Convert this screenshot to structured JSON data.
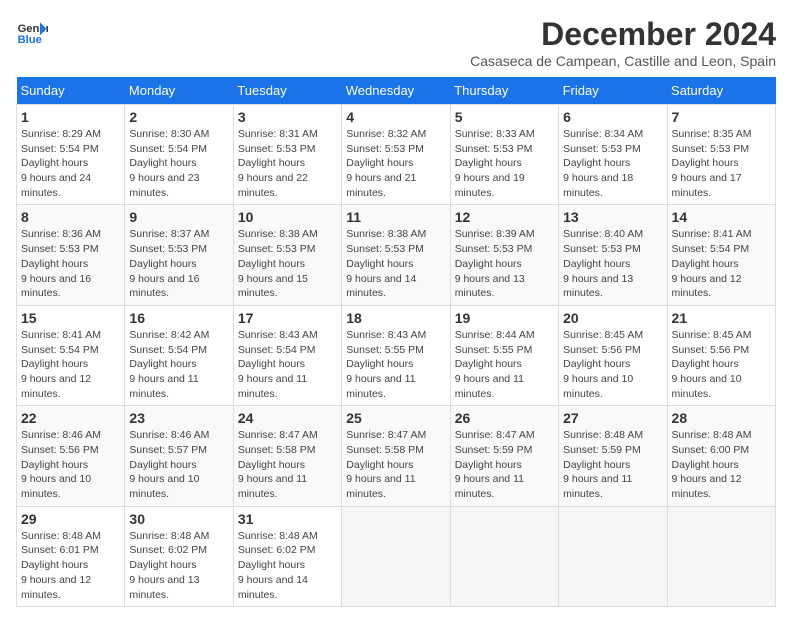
{
  "logo": {
    "line1": "General",
    "line2": "Blue"
  },
  "title": "December 2024",
  "subtitle": "Casaseca de Campean, Castille and Leon, Spain",
  "weekdays": [
    "Sunday",
    "Monday",
    "Tuesday",
    "Wednesday",
    "Thursday",
    "Friday",
    "Saturday"
  ],
  "weeks": [
    [
      {
        "day": "1",
        "sunrise": "8:29 AM",
        "sunset": "5:54 PM",
        "daylight": "9 hours and 24 minutes."
      },
      {
        "day": "2",
        "sunrise": "8:30 AM",
        "sunset": "5:54 PM",
        "daylight": "9 hours and 23 minutes."
      },
      {
        "day": "3",
        "sunrise": "8:31 AM",
        "sunset": "5:53 PM",
        "daylight": "9 hours and 22 minutes."
      },
      {
        "day": "4",
        "sunrise": "8:32 AM",
        "sunset": "5:53 PM",
        "daylight": "9 hours and 21 minutes."
      },
      {
        "day": "5",
        "sunrise": "8:33 AM",
        "sunset": "5:53 PM",
        "daylight": "9 hours and 19 minutes."
      },
      {
        "day": "6",
        "sunrise": "8:34 AM",
        "sunset": "5:53 PM",
        "daylight": "9 hours and 18 minutes."
      },
      {
        "day": "7",
        "sunrise": "8:35 AM",
        "sunset": "5:53 PM",
        "daylight": "9 hours and 17 minutes."
      }
    ],
    [
      {
        "day": "8",
        "sunrise": "8:36 AM",
        "sunset": "5:53 PM",
        "daylight": "9 hours and 16 minutes."
      },
      {
        "day": "9",
        "sunrise": "8:37 AM",
        "sunset": "5:53 PM",
        "daylight": "9 hours and 16 minutes."
      },
      {
        "day": "10",
        "sunrise": "8:38 AM",
        "sunset": "5:53 PM",
        "daylight": "9 hours and 15 minutes."
      },
      {
        "day": "11",
        "sunrise": "8:38 AM",
        "sunset": "5:53 PM",
        "daylight": "9 hours and 14 minutes."
      },
      {
        "day": "12",
        "sunrise": "8:39 AM",
        "sunset": "5:53 PM",
        "daylight": "9 hours and 13 minutes."
      },
      {
        "day": "13",
        "sunrise": "8:40 AM",
        "sunset": "5:53 PM",
        "daylight": "9 hours and 13 minutes."
      },
      {
        "day": "14",
        "sunrise": "8:41 AM",
        "sunset": "5:54 PM",
        "daylight": "9 hours and 12 minutes."
      }
    ],
    [
      {
        "day": "15",
        "sunrise": "8:41 AM",
        "sunset": "5:54 PM",
        "daylight": "9 hours and 12 minutes."
      },
      {
        "day": "16",
        "sunrise": "8:42 AM",
        "sunset": "5:54 PM",
        "daylight": "9 hours and 11 minutes."
      },
      {
        "day": "17",
        "sunrise": "8:43 AM",
        "sunset": "5:54 PM",
        "daylight": "9 hours and 11 minutes."
      },
      {
        "day": "18",
        "sunrise": "8:43 AM",
        "sunset": "5:55 PM",
        "daylight": "9 hours and 11 minutes."
      },
      {
        "day": "19",
        "sunrise": "8:44 AM",
        "sunset": "5:55 PM",
        "daylight": "9 hours and 11 minutes."
      },
      {
        "day": "20",
        "sunrise": "8:45 AM",
        "sunset": "5:56 PM",
        "daylight": "9 hours and 10 minutes."
      },
      {
        "day": "21",
        "sunrise": "8:45 AM",
        "sunset": "5:56 PM",
        "daylight": "9 hours and 10 minutes."
      }
    ],
    [
      {
        "day": "22",
        "sunrise": "8:46 AM",
        "sunset": "5:56 PM",
        "daylight": "9 hours and 10 minutes."
      },
      {
        "day": "23",
        "sunrise": "8:46 AM",
        "sunset": "5:57 PM",
        "daylight": "9 hours and 10 minutes."
      },
      {
        "day": "24",
        "sunrise": "8:47 AM",
        "sunset": "5:58 PM",
        "daylight": "9 hours and 11 minutes."
      },
      {
        "day": "25",
        "sunrise": "8:47 AM",
        "sunset": "5:58 PM",
        "daylight": "9 hours and 11 minutes."
      },
      {
        "day": "26",
        "sunrise": "8:47 AM",
        "sunset": "5:59 PM",
        "daylight": "9 hours and 11 minutes."
      },
      {
        "day": "27",
        "sunrise": "8:48 AM",
        "sunset": "5:59 PM",
        "daylight": "9 hours and 11 minutes."
      },
      {
        "day": "28",
        "sunrise": "8:48 AM",
        "sunset": "6:00 PM",
        "daylight": "9 hours and 12 minutes."
      }
    ],
    [
      {
        "day": "29",
        "sunrise": "8:48 AM",
        "sunset": "6:01 PM",
        "daylight": "9 hours and 12 minutes."
      },
      {
        "day": "30",
        "sunrise": "8:48 AM",
        "sunset": "6:02 PM",
        "daylight": "9 hours and 13 minutes."
      },
      {
        "day": "31",
        "sunrise": "8:48 AM",
        "sunset": "6:02 PM",
        "daylight": "9 hours and 14 minutes."
      },
      null,
      null,
      null,
      null
    ]
  ]
}
